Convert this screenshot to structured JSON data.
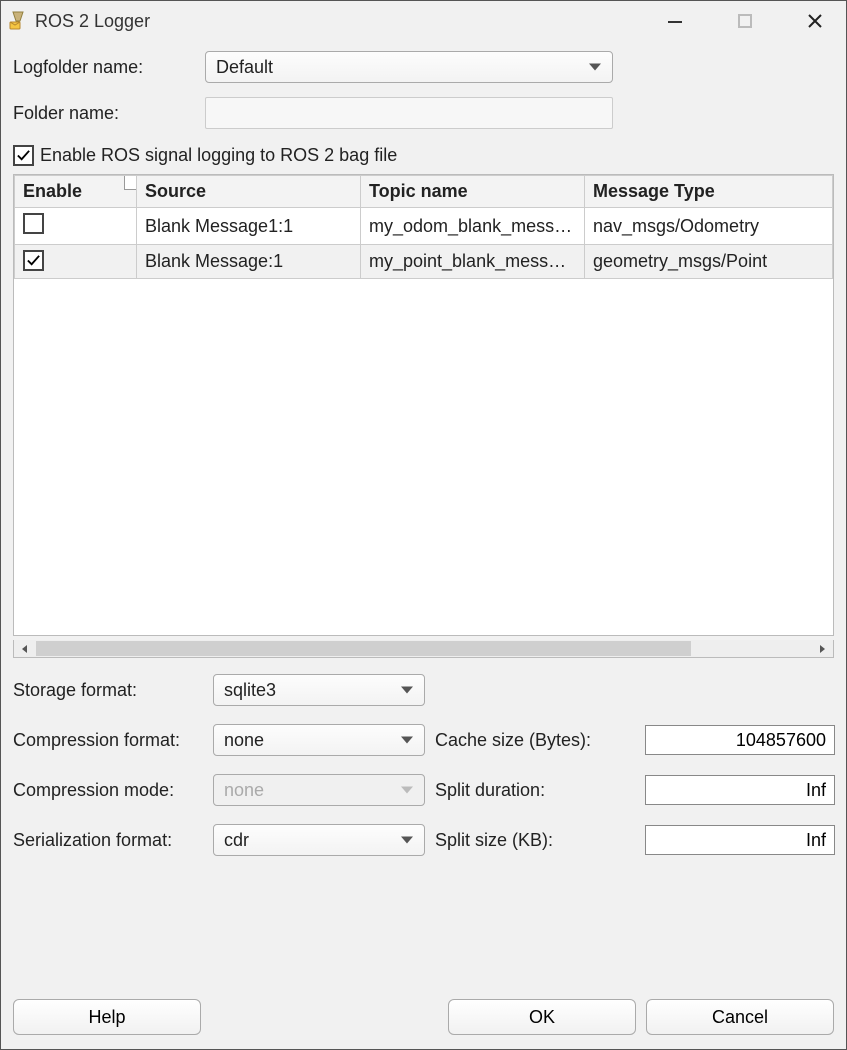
{
  "window": {
    "title": "ROS 2 Logger"
  },
  "form": {
    "logfolder_label": "Logfolder name:",
    "logfolder_value": "Default",
    "foldername_label": "Folder name:",
    "foldername_value": "",
    "enable_logging_label": "Enable ROS signal logging to ROS 2 bag file",
    "enable_logging_checked": true
  },
  "table": {
    "headers": {
      "enable": "Enable",
      "source": "Source",
      "topic": "Topic name",
      "msgtype": "Message Type"
    },
    "rows": [
      {
        "enable": false,
        "source": "Blank Message1:1",
        "topic": "my_odom_blank_messa…",
        "msgtype": "nav_msgs/Odometry"
      },
      {
        "enable": true,
        "source": "Blank Message:1",
        "topic": "my_point_blank_message",
        "msgtype": "geometry_msgs/Point"
      }
    ]
  },
  "options": {
    "storage_format_label": "Storage format:",
    "storage_format_value": "sqlite3",
    "compression_format_label": "Compression format:",
    "compression_format_value": "none",
    "compression_mode_label": "Compression mode:",
    "compression_mode_value": "none",
    "serialization_format_label": "Serialization format:",
    "serialization_format_value": "cdr",
    "cache_size_label": "Cache size (Bytes):",
    "cache_size_value": "104857600",
    "split_duration_label": "Split duration:",
    "split_duration_value": "Inf",
    "split_size_label": "Split size (KB):",
    "split_size_value": "Inf"
  },
  "footer": {
    "help": "Help",
    "ok": "OK",
    "cancel": "Cancel"
  }
}
